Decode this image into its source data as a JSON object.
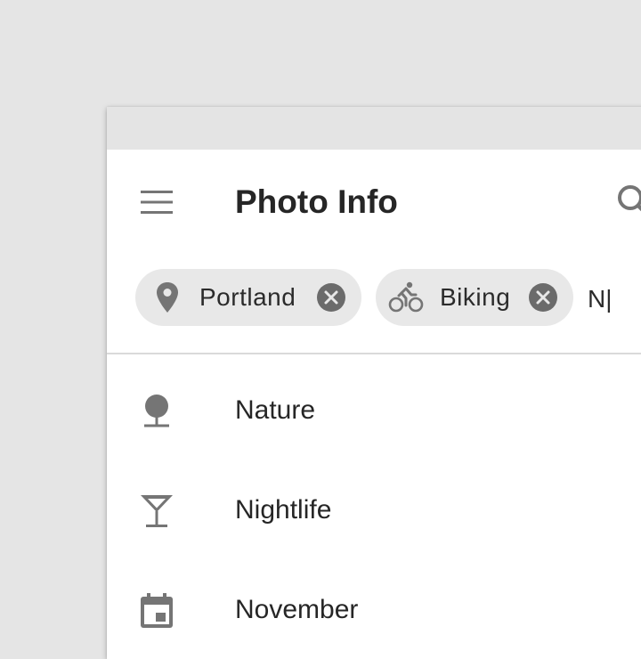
{
  "app_bar": {
    "title": "Photo Info",
    "menu_icon": "menu-icon",
    "search_icon": "search-icon"
  },
  "chips": [
    {
      "label": "Portland",
      "icon": "location-pin-icon"
    },
    {
      "label": "Biking",
      "icon": "bike-icon"
    }
  ],
  "chip_input": {
    "value": "N|"
  },
  "suggestions": [
    {
      "label": "Nature",
      "icon": "tree-icon"
    },
    {
      "label": "Nightlife",
      "icon": "cocktail-icon"
    },
    {
      "label": "November",
      "icon": "calendar-icon"
    }
  ],
  "colors": {
    "background": "#e5e5e5",
    "status_bar": "#e4e4e4",
    "chip": "#e8e8e8",
    "icon": "#757575",
    "text": "#262626"
  }
}
